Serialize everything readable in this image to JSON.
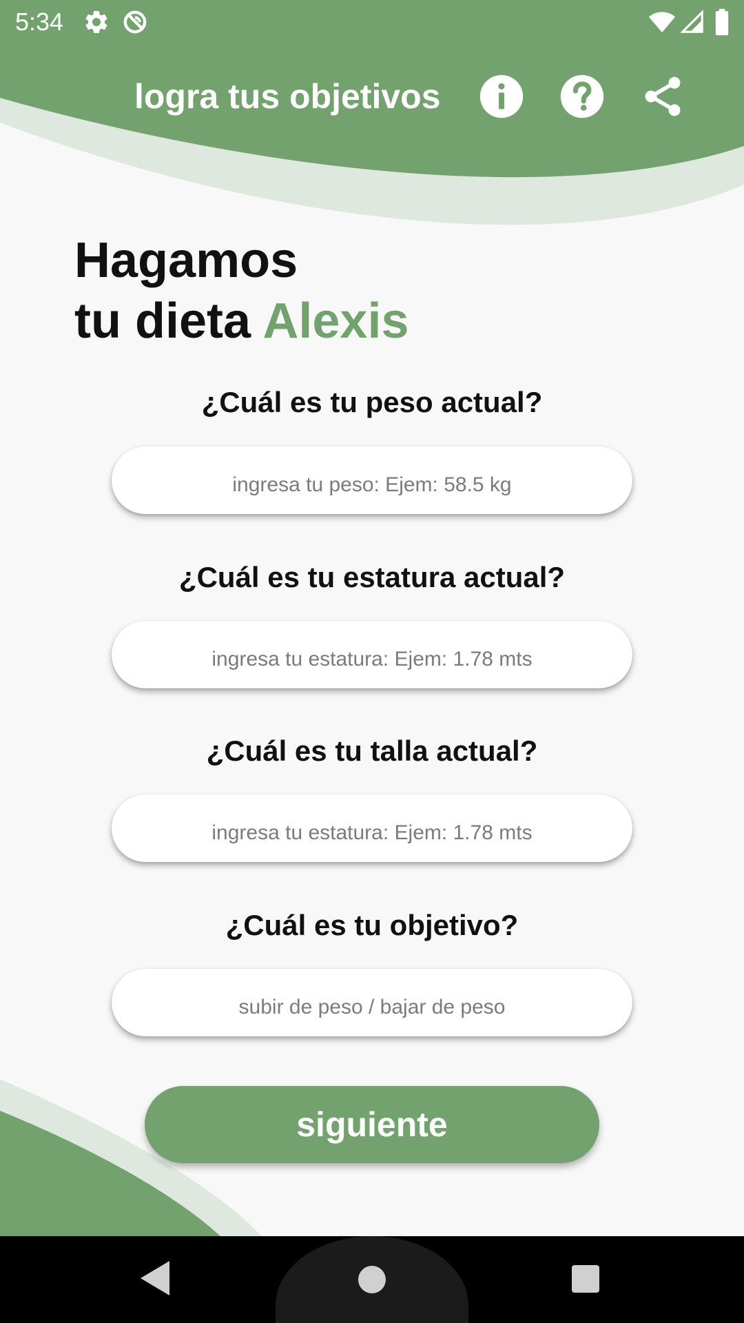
{
  "status_bar": {
    "time": "5:34",
    "icons": [
      "gear-icon",
      "sync-disabled-icon",
      "wifi-icon",
      "signal-icon",
      "battery-icon"
    ]
  },
  "app_bar": {
    "title": "logra tus objetivos",
    "actions": [
      "info-icon",
      "help-icon",
      "share-icon"
    ]
  },
  "headline": {
    "line1": "Hagamos",
    "line2_prefix": "tu dieta",
    "user_name": "Alexis"
  },
  "form": {
    "weight": {
      "question": "¿Cuál es tu peso actual?",
      "placeholder": "ingresa tu peso: Ejem: 58.5 kg",
      "value": ""
    },
    "height": {
      "question": "¿Cuál es tu estatura actual?",
      "placeholder": "ingresa tu estatura: Ejem: 1.78 mts",
      "value": ""
    },
    "size": {
      "question": "¿Cuál es tu talla actual?",
      "placeholder": "ingresa tu estatura: Ejem: 1.78 mts",
      "value": ""
    },
    "goal": {
      "question": "¿Cuál es tu objetivo?",
      "placeholder": "subir de peso / bajar de peso",
      "value": ""
    }
  },
  "next_button": {
    "label": "siguiente"
  },
  "nav_bar": {
    "buttons": [
      "back-icon",
      "home-icon",
      "recents-icon"
    ]
  },
  "colors": {
    "accent": "#74a26f",
    "accent_light": "#dfe8df",
    "background": "#f8f8f8",
    "text": "#111111",
    "placeholder": "#7b7b7b"
  }
}
